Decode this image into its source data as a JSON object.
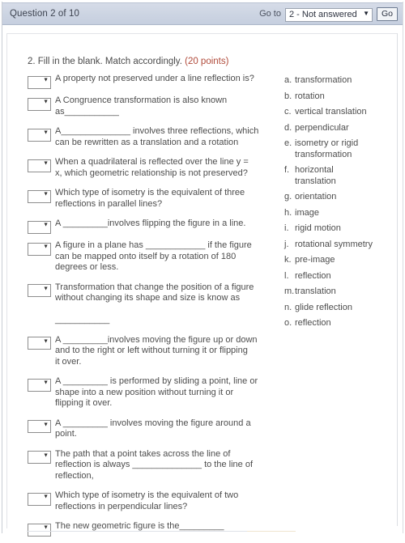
{
  "status_bar": {
    "title": "Question 2 of 10",
    "goto_label": "Go to",
    "goto_selected": "2 - Not answered",
    "goto_options": [
      "2 - Not answered"
    ],
    "go_button": "Go",
    "chevron": "▼"
  },
  "question": {
    "number_and_prompt": "2. Fill in the blank. Match accordingly.",
    "points": "(20 points)",
    "points_color": "#b04a3a",
    "select_chevron": "▼",
    "select_placeholder": "",
    "items": [
      {
        "text": "A property not preserved under a line reflection is?"
      },
      {
        "text": "A Congruence transformation is also known\nas___________"
      },
      {
        "text": "A______________ involves three reflections, which\ncan be rewritten as a translation and a rotation"
      },
      {
        "text": "When a quadrilateral is reflected over the line y =\nx, which geometric relationship is not preserved?"
      },
      {
        "text": "Which type of isometry is the equivalent of three\nreflections in parallel lines?"
      },
      {
        "text": "A _________involves flipping the figure in a line."
      },
      {
        "text": "A figure in a plane has ____________ if the figure\ncan be mapped onto itself by a rotation of 180\ndegrees or less."
      },
      {
        "text": "Transformation that change the position of a figure\nwithout changing its shape and size is know as\n\n___________"
      },
      {
        "text": "A _________involves moving the figure up or down\nand to the right or left without turning it or flipping\nit over."
      },
      {
        "text": "A _________ is performed by sliding a point, line or\nshape into a new position without turning it or\nflipping it over."
      },
      {
        "text": "A _________ involves moving the figure around a\npoint."
      },
      {
        "text": "The path that a point takes across the line of\nreflection is always ______________ to the line of\nreflection,"
      },
      {
        "text": "Which type of isometry is the equivalent of two\nreflections in perpendicular lines?"
      },
      {
        "text": "The new geometric figure is the_________"
      }
    ],
    "options": [
      {
        "letter": "a.",
        "text": "transformation"
      },
      {
        "letter": "b.",
        "text": "rotation"
      },
      {
        "letter": "c.",
        "text": "vertical translation"
      },
      {
        "letter": "d.",
        "text": "perpendicular"
      },
      {
        "letter": "e.",
        "text": "isometry or rigid\ntransformation"
      },
      {
        "letter": "f.",
        "text": "horizontal\ntranslation"
      },
      {
        "letter": "g.",
        "text": "orientation"
      },
      {
        "letter": "h.",
        "text": "image"
      },
      {
        "letter": "i.",
        "text": "rigid motion"
      },
      {
        "letter": "j.",
        "text": "rotational symmetry"
      },
      {
        "letter": "k.",
        "text": "pre-image"
      },
      {
        "letter": "l.",
        "text": "reflection"
      },
      {
        "letter": "m.",
        "text": "translation"
      },
      {
        "letter": "n.",
        "text": "glide reflection"
      },
      {
        "letter": "o.",
        "text": "reflection"
      }
    ]
  }
}
